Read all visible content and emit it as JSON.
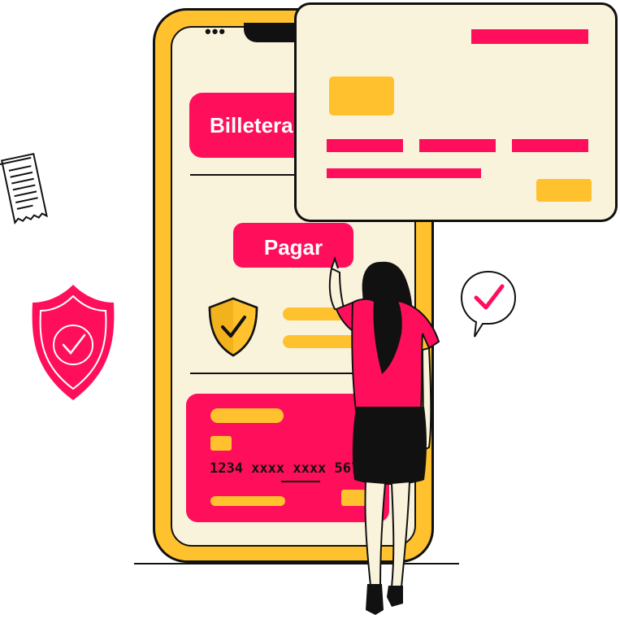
{
  "wallet_button": {
    "label": "Billetera"
  },
  "pay_button": {
    "label": "Pagar"
  },
  "card": {
    "number": "1234 xxxx xxxx 5678"
  },
  "colors": {
    "accent_pink": "#FF0F5B",
    "accent_yellow": "#FFC22E",
    "screen_cream": "#FAF3DC",
    "outline": "#111111"
  },
  "icons": {
    "receipt": "receipt-icon",
    "shield": "shield-check-icon",
    "speech": "speech-check-icon",
    "phone_shield": "shield-check-icon"
  }
}
